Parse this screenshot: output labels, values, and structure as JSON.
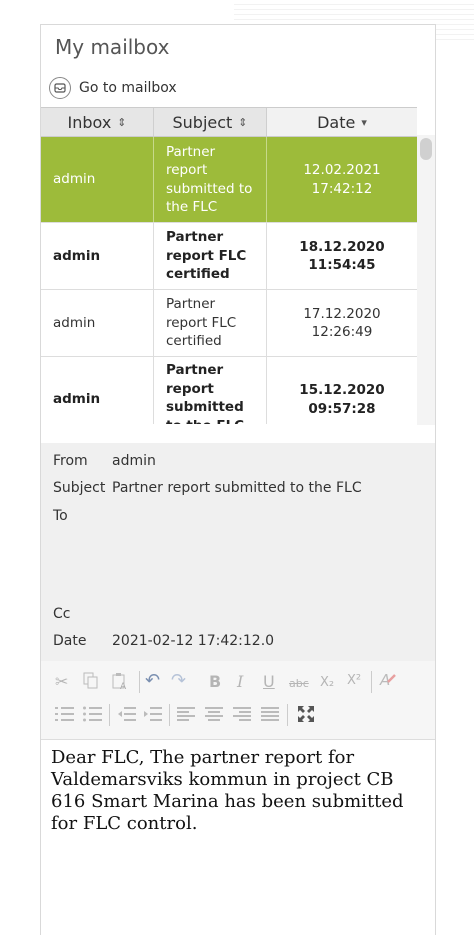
{
  "widget": {
    "title": "My mailbox",
    "goto_label": "Go to mailbox"
  },
  "table": {
    "headers": [
      {
        "label": "Inbox",
        "sort": "⇕"
      },
      {
        "label": "Subject",
        "sort": "⇕"
      },
      {
        "label": "Date",
        "sort": "▾"
      }
    ],
    "rows": [
      {
        "from": "admin",
        "subject": "Partner report submitted to the FLC",
        "date": "12.02.2021",
        "time": "17:42:12"
      },
      {
        "from": "admin",
        "subject": "Partner report FLC certified",
        "date": "18.12.2020",
        "time": "11:54:45"
      },
      {
        "from": "admin",
        "subject": "Partner report FLC certified",
        "date": "17.12.2020",
        "time": "12:26:49"
      },
      {
        "from": "admin",
        "subject": "Partner report submitted to the FLC",
        "date": "15.12.2020",
        "time": "09:57:28"
      }
    ]
  },
  "message": {
    "from_label": "From",
    "from_value": "admin",
    "subject_label": "Subject",
    "subject_value": "Partner report submitted to the FLC",
    "to_label": "To",
    "cc_label": "Cc",
    "date_label": "Date",
    "date_value": "2021-02-12 17:42:12.0",
    "body": "Dear FLC, The partner report for Valdemarsviks kommun in project CB 616 Smart Marina has been submitted for FLC control."
  },
  "toolbar": {
    "strike_label": "abc",
    "subscript_label": "X₂",
    "superscript_label": "X²"
  },
  "colors": {
    "selected_row": "#9dbb3a"
  }
}
